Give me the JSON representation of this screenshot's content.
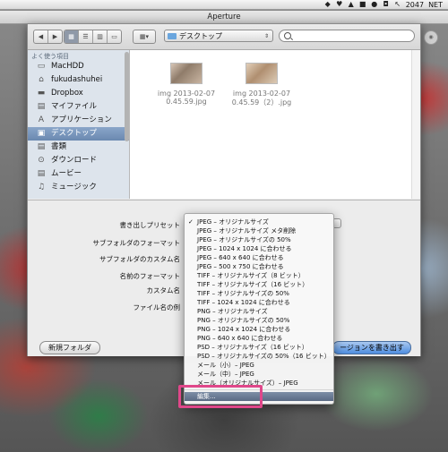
{
  "menubar": {
    "time": "2047",
    "net": "NET"
  },
  "window": {
    "title": "Aperture"
  },
  "toolbar": {
    "path_label": "デスクトップ",
    "search_placeholder": ""
  },
  "sidebar": {
    "header": "よく使う項目",
    "items": [
      {
        "label": "MacHDD",
        "icon": "disk-icon"
      },
      {
        "label": "fukudashuhei",
        "icon": "home-icon"
      },
      {
        "label": "Dropbox",
        "icon": "folder-icon"
      },
      {
        "label": "マイファイル",
        "icon": "files-icon"
      },
      {
        "label": "アプリケーション",
        "icon": "apps-icon"
      },
      {
        "label": "デスクトップ",
        "icon": "desktop-icon",
        "selected": true
      },
      {
        "label": "書類",
        "icon": "documents-icon"
      },
      {
        "label": "ダウンロード",
        "icon": "downloads-icon"
      },
      {
        "label": "ムービー",
        "icon": "movies-icon"
      },
      {
        "label": "ミュージック",
        "icon": "music-icon"
      }
    ]
  },
  "files": [
    {
      "name_line1": "img 2013-02-07",
      "name_line2": "0.45.59.jpg"
    },
    {
      "name_line1": "img 2013-02-07",
      "name_line2": "0.45.59（2）.jpg"
    }
  ],
  "settings": {
    "preset_label": "書き出しプリセット",
    "subfolder_format_label": "サブフォルダのフォーマット",
    "subfolder_custom_label": "サブフォルダのカスタム名",
    "name_format_label": "名前のフォーマット",
    "custom_name_label": "カスタム名",
    "filename_example_label": "ファイル名の例",
    "new_folder_button": "新規フォルダ",
    "export_button": "ージョンを書き出す"
  },
  "menu": {
    "items": [
      {
        "label": "JPEG – オリジナルサイズ",
        "checked": true
      },
      {
        "label": "JPEG – オリジナルサイズ メタ削除"
      },
      {
        "label": "JPEG – オリジナルサイズの 50%"
      },
      {
        "label": "JPEG – 1024 x 1024 に合わせる"
      },
      {
        "label": "JPEG – 640 x 640 に合わせる"
      },
      {
        "label": "JPEG – 500 x 750 に合わせる"
      },
      {
        "label": "TIFF – オリジナルサイズ（8 ビット）"
      },
      {
        "label": "TIFF – オリジナルサイズ（16 ビット）"
      },
      {
        "label": "TIFF – オリジナルサイズの 50%"
      },
      {
        "label": "TIFF – 1024 x 1024 に合わせる"
      },
      {
        "label": "PNG – オリジナルサイズ"
      },
      {
        "label": "PNG – オリジナルサイズの 50%"
      },
      {
        "label": "PNG – 1024 x 1024 に合わせる"
      },
      {
        "label": "PNG – 640 x 640 に合わせる"
      },
      {
        "label": "PSD – オリジナルサイズ（16 ビット）"
      },
      {
        "label": "PSD – オリジナルサイズの 50%（16 ビット）"
      },
      {
        "label": "メール（小）– JPEG"
      },
      {
        "label": "メール（中）– JPEG"
      },
      {
        "label": "メール（オリジナルサイズ）– JPEG"
      }
    ],
    "edit_item": "編集..."
  }
}
